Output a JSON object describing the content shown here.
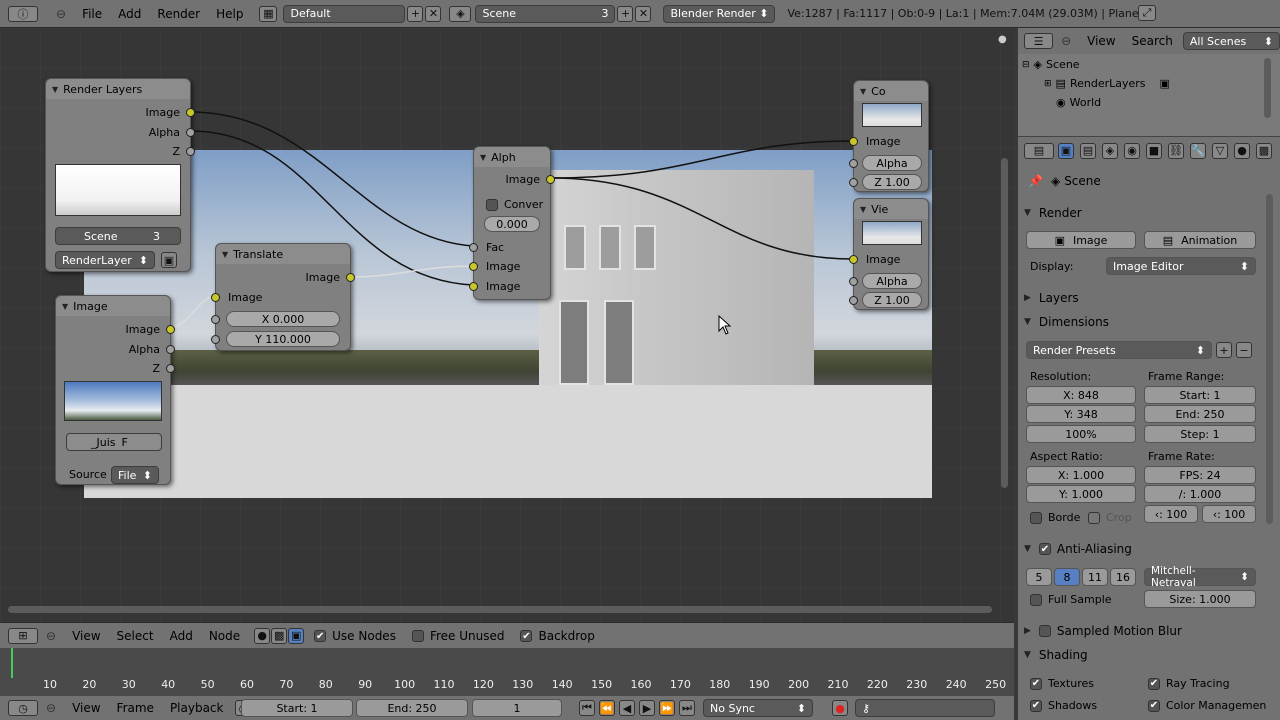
{
  "topbar": {
    "menus": [
      "File",
      "Add",
      "Render",
      "Help"
    ],
    "screen_layout": "Default",
    "scene": "Scene",
    "scene_users": "3",
    "render_engine": "Blender Render",
    "stats": "Ve:1287 | Fa:1117 | Ob:0-9 | La:1 | Mem:7.04M (29.03M) | Plane"
  },
  "nodes": {
    "render_layers": {
      "title": "Render Layers",
      "outputs": [
        "Image",
        "Alpha",
        "Z"
      ],
      "scene": "Scene",
      "scene_users": "3",
      "layer": "RenderLayer"
    },
    "image": {
      "title": "Image",
      "outputs": [
        "Image",
        "Alpha",
        "Z"
      ],
      "file_name": "_Juis",
      "file_flag": "F",
      "source_label": "Source",
      "source_value": "File"
    },
    "translate": {
      "title": "Translate",
      "output": "Image",
      "input": "Image",
      "x": "X 0.000",
      "y": "Y 110.000"
    },
    "alpha_over": {
      "title": "Alph",
      "output": "Image",
      "convert": "Conver",
      "value": "0.000",
      "inputs": [
        "Fac",
        "Image",
        "Image"
      ]
    },
    "composite": {
      "title": "Co",
      "input": "Image",
      "alpha": "Alpha",
      "z": "Z 1.00"
    },
    "viewer": {
      "title": "Vie",
      "input": "Image",
      "alpha": "Alpha",
      "z": "Z 1.00"
    }
  },
  "node_toolbar": {
    "menus": [
      "View",
      "Select",
      "Add",
      "Node"
    ],
    "use_nodes": "Use Nodes",
    "free_unused": "Free Unused",
    "backdrop": "Backdrop"
  },
  "timeline": {
    "ticks": [
      "10",
      "20",
      "30",
      "40",
      "50",
      "60",
      "70",
      "80",
      "90",
      "100",
      "110",
      "120",
      "130",
      "140",
      "150",
      "160",
      "170",
      "180",
      "190",
      "200",
      "210",
      "220",
      "230",
      "240",
      "250"
    ],
    "menus": [
      "View",
      "Frame",
      "Playback"
    ],
    "start": "Start: 1",
    "end": "End: 250",
    "current": "1",
    "sync": "No Sync"
  },
  "outliner": {
    "view": "View",
    "search": "Search",
    "filter": "All Scenes",
    "items": [
      "Scene",
      "RenderLayers",
      "World"
    ]
  },
  "properties": {
    "context": "Scene",
    "render_panel": "Render",
    "image_btn": "Image",
    "animation_btn": "Animation",
    "display_label": "Display:",
    "display_value": "Image Editor",
    "layers_panel": "Layers",
    "dimensions_panel": "Dimensions",
    "render_presets": "Render Presets",
    "resolution_label": "Resolution:",
    "res_x": "X: 848",
    "res_y": "Y: 348",
    "res_pct": "100%",
    "frame_range_label": "Frame Range:",
    "start": "Start: 1",
    "end": "End: 250",
    "step": "Step: 1",
    "aspect_label": "Aspect Ratio:",
    "aspect_x": "X: 1.000",
    "aspect_y": "Y: 1.000",
    "frame_rate_label": "Frame Rate:",
    "fps": "FPS: 24",
    "fps_base": "/: 1.000",
    "border": "Borde",
    "crop": "Crop",
    "old": "100",
    "new": "100",
    "aa_panel": "Anti-Aliasing",
    "aa_samples": [
      "5",
      "8",
      "11",
      "16"
    ],
    "aa_filter": "Mitchell-Netraval",
    "full_sample": "Full Sample",
    "aa_size": "Size: 1.000",
    "motion_blur": "Sampled Motion Blur",
    "shading_panel": "Shading",
    "textures": "Textures",
    "ray_tracing": "Ray Tracing",
    "shadows": "Shadows",
    "color_management": "Color Managemen"
  }
}
